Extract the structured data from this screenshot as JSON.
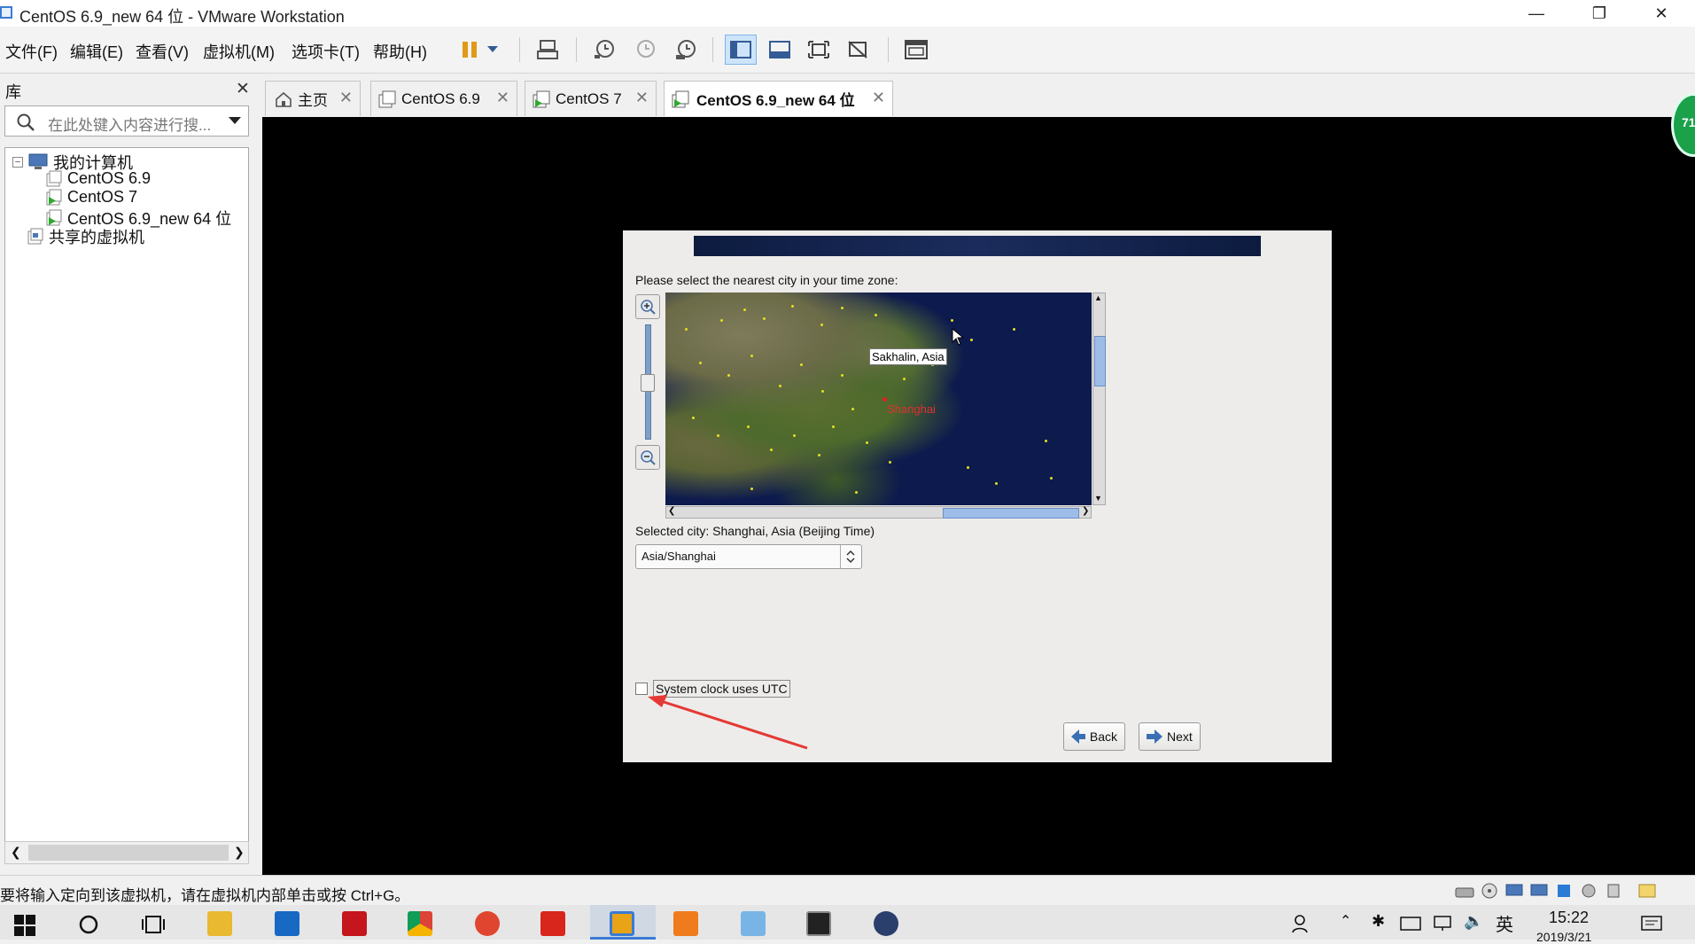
{
  "window": {
    "title": "CentOS 6.9_new 64 位 - VMware Workstation"
  },
  "menu": [
    "文件(F)",
    "编辑(E)",
    "查看(V)",
    "虚拟机(M)",
    "选项卡(T)",
    "帮助(H)"
  ],
  "library": {
    "title": "库",
    "search_placeholder": "在此处键入内容进行搜...",
    "tree": {
      "root": "我的计算机",
      "vms": [
        "CentOS 6.9",
        "CentOS 7",
        "CentOS 6.9_new 64 位"
      ],
      "shared": "共享的虚拟机"
    }
  },
  "tabs": [
    {
      "label": "主页"
    },
    {
      "label": "CentOS 6.9"
    },
    {
      "label": "CentOS 7"
    },
    {
      "label": "CentOS 6.9_new 64 位"
    }
  ],
  "installer": {
    "prompt": "Please select the nearest city in your time zone:",
    "tooltip": "Sakhalin, Asia",
    "highlighted_city": "Shanghai",
    "selected_city": "Selected city: Shanghai, Asia (Beijing Time)",
    "timezone_value": "Asia/Shanghai",
    "utc_label": "System clock uses UTC",
    "utc_checked": false,
    "back_label": "Back",
    "next_label": "Next"
  },
  "status": {
    "message": "要将输入定向到该虚拟机，请在虚拟机内部单击或按 Ctrl+G。"
  },
  "taskbar": {
    "time": "15:22",
    "date": "2019/3/21",
    "ime": "英"
  },
  "badge": {
    "text": "71"
  },
  "colors": {
    "accent": "#1b2c5c",
    "selected_tab_bg": "#ffffff",
    "vm_bg": "#000000",
    "city": "#e03030",
    "annotation_arrow": "#e53935"
  }
}
